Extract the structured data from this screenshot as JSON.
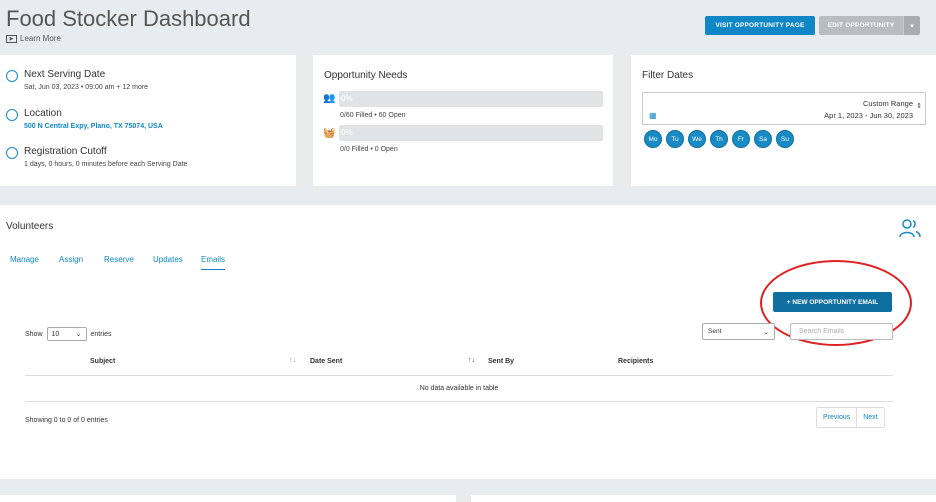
{
  "header": {
    "title": "Food Stocker Dashboard",
    "learn_more": "Learn More",
    "visit_button": "VISIT OPPORTUNITY PAGE",
    "edit_button": "EDIT OPPORTUNITY",
    "caret": "▾"
  },
  "info": {
    "next_serving_label": "Next Serving Date",
    "next_serving_value": "Sat, Jun 03, 2023 • 09:00 am + 12 more",
    "location_label": "Location",
    "location_value": "500 N Central Expy, Plano, TX 75074, USA",
    "cutoff_label": "Registration Cutoff",
    "cutoff_value": "1 days, 0 hours, 0 minutes before each Serving Date"
  },
  "needs": {
    "title": "Opportunity Needs",
    "items": [
      {
        "percent": "0%",
        "fill": 0,
        "detail": "0/60 Filled • 60 Open",
        "icon": "users-icon"
      },
      {
        "percent": "0%",
        "fill": 0,
        "detail": "0/0 Filled • 0 Open",
        "icon": "basket-icon"
      }
    ]
  },
  "filter": {
    "title": "Filter Dates",
    "range_label": "Custom Range",
    "range_value": "Apr 1, 2023 - Jun 30, 2023",
    "days": [
      "Mo",
      "Tu",
      "We",
      "Th",
      "Fr",
      "Sa",
      "Su"
    ]
  },
  "volunteers": {
    "title": "Volunteers",
    "tabs": [
      "Manage",
      "Assign",
      "Reserve",
      "Updates",
      "Emails"
    ],
    "active_tab": "Emails",
    "new_email_button": "+ NEW OPPORTUNITY EMAIL",
    "show_label": "Show",
    "entries_value": "10",
    "entries_label": "entries",
    "sent_filter": "Sent",
    "search_placeholder": "Search Emails",
    "columns": [
      "Subject",
      "Date Sent",
      "Sent By",
      "Recipients"
    ],
    "sort_glyph": "↑↓",
    "no_data": "No data available in table",
    "showing": "Showing 0 to 0 of 0 entries",
    "prev": "Previous",
    "next": "Next"
  },
  "colors": {
    "accent": "#0f87c6",
    "highlight": "#e02020"
  }
}
